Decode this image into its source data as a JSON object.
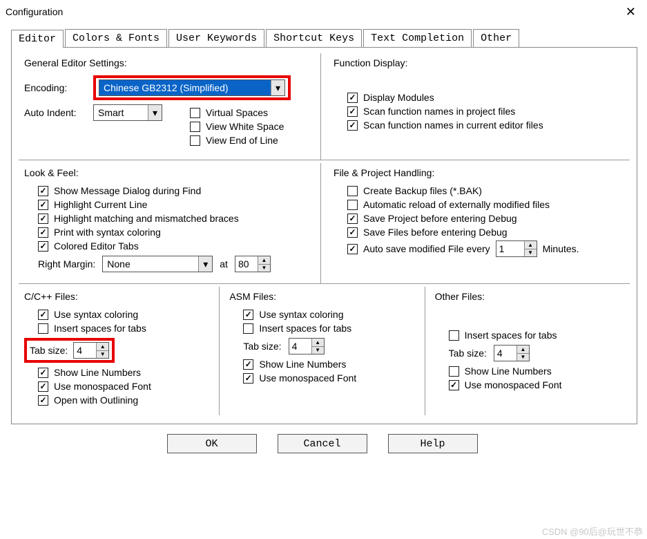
{
  "window": {
    "title": "Configuration"
  },
  "tabs": {
    "editor": "Editor",
    "colors": "Colors & Fonts",
    "keywords": "User Keywords",
    "shortcuts": "Shortcut Keys",
    "completion": "Text Completion",
    "other": "Other"
  },
  "general": {
    "title": "General Editor Settings:",
    "encoding_label": "Encoding:",
    "encoding_value": "Chinese GB2312 (Simplified)",
    "autoindent_label": "Auto Indent:",
    "autoindent_value": "Smart",
    "virtual_spaces": "Virtual Spaces",
    "view_whitespace": "View White Space",
    "view_eol": "View End of Line"
  },
  "funcdisp": {
    "title": "Function Display:",
    "display_modules": "Display Modules",
    "scan_project": "Scan function names in project files",
    "scan_current": "Scan function names in current editor files"
  },
  "look": {
    "title": "Look & Feel:",
    "msg_dialog": "Show Message Dialog during Find",
    "highlight_line": "Highlight Current Line",
    "highlight_braces": "Highlight matching and mismatched braces",
    "print_syntax": "Print with syntax coloring",
    "colored_tabs": "Colored Editor Tabs",
    "right_margin_label": "Right Margin:",
    "right_margin_value": "None",
    "at": "at",
    "at_value": "80"
  },
  "file": {
    "title": "File & Project Handling:",
    "backup": "Create Backup files (*.BAK)",
    "autoreload": "Automatic reload of externally modified files",
    "save_project": "Save Project before entering Debug",
    "save_files": "Save Files before entering Debug",
    "autosave": "Auto save modified File every",
    "autosave_value": "1",
    "minutes": "Minutes."
  },
  "cfiles": {
    "title": "C/C++ Files:",
    "syntax": "Use syntax coloring",
    "spaces": "Insert spaces for tabs",
    "tab_label": "Tab size:",
    "tab_value": "4",
    "linenum": "Show Line Numbers",
    "mono": "Use monospaced Font",
    "outlining": "Open with Outlining"
  },
  "asmfiles": {
    "title": "ASM Files:",
    "syntax": "Use syntax coloring",
    "spaces": "Insert spaces for tabs",
    "tab_label": "Tab size:",
    "tab_value": "4",
    "linenum": "Show Line Numbers",
    "mono": "Use monospaced Font"
  },
  "otherfiles": {
    "title": "Other Files:",
    "spaces": "Insert spaces for tabs",
    "tab_label": "Tab size:",
    "tab_value": "4",
    "linenum": "Show Line Numbers",
    "mono": "Use monospaced Font"
  },
  "buttons": {
    "ok": "OK",
    "cancel": "Cancel",
    "help": "Help"
  },
  "watermark": "CSDN @90后@玩世不恭"
}
